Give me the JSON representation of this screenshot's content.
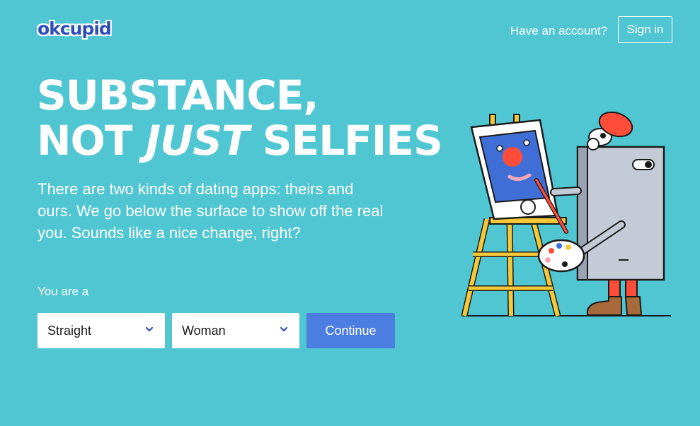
{
  "header": {
    "logo_text": "okcupid",
    "have_account": "Have an account?",
    "signin_label": "Sign in"
  },
  "hero": {
    "headline_line1": "SUBSTANCE,",
    "headline_line2_a": "NOT ",
    "headline_line2_em": "JUST",
    "headline_line2_b": " SELFIES",
    "subtext": "There are two kinds of dating apps: theirs and ours. We go below the surface to show off the real you. Sounds like a nice change, right?"
  },
  "form": {
    "you_are_label": "You are a",
    "orientation_value": "Straight",
    "gender_value": "Woman",
    "continue_label": "Continue"
  },
  "colors": {
    "background": "#50c6d2",
    "brand_blue": "#2f4fb8",
    "button_blue": "#4c7de0"
  },
  "icons": {
    "dropdown": "chevron-down-icon",
    "illustration": "painter-phone-easel-illustration"
  }
}
